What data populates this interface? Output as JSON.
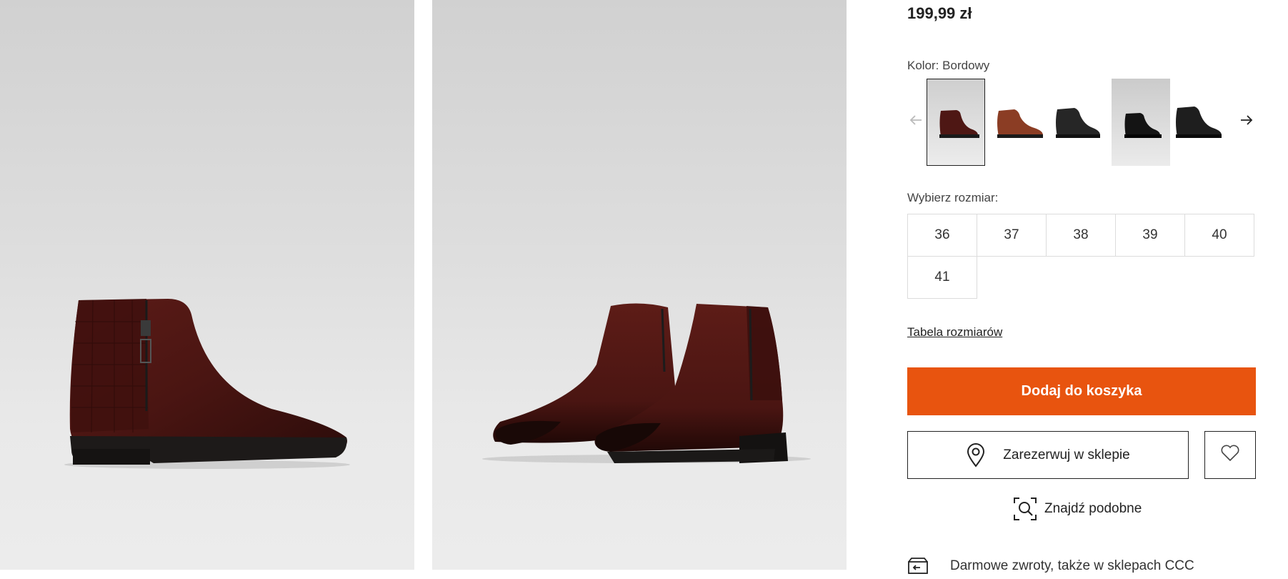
{
  "product": {
    "price": "199,99 zł"
  },
  "color": {
    "label": "Kolor:",
    "value": "Bordowy",
    "swatches": [
      {
        "name": "bordowy",
        "hex": "#5a1a16",
        "selected": true
      },
      {
        "name": "brązowy",
        "hex": "#8b3d24"
      },
      {
        "name": "czarny",
        "hex": "#1f1f1f"
      },
      {
        "name": "czarny-2",
        "hex": "#111111"
      },
      {
        "name": "czarny-3",
        "hex": "#1a1a1a"
      }
    ]
  },
  "sizes": {
    "label": "Wybierz rozmiar:",
    "options": [
      "36",
      "37",
      "38",
      "39",
      "40",
      "41"
    ]
  },
  "links": {
    "size_table": "Tabela rozmiarów"
  },
  "actions": {
    "add_to_cart": "Dodaj do koszyka",
    "reserve": "Zarezerwuj w sklepie",
    "find_similar": "Znajdź podobne"
  },
  "info": {
    "returns": "Darmowe zwroty, także w sklepach CCC"
  },
  "colors": {
    "accent": "#e8540f",
    "boot": "#4e1714"
  },
  "icons": {
    "prev": "arrow-left-icon",
    "next": "arrow-right-icon",
    "reserve": "location-pin-icon",
    "wishlist": "heart-icon",
    "similar": "image-search-icon",
    "returns": "package-return-icon"
  }
}
